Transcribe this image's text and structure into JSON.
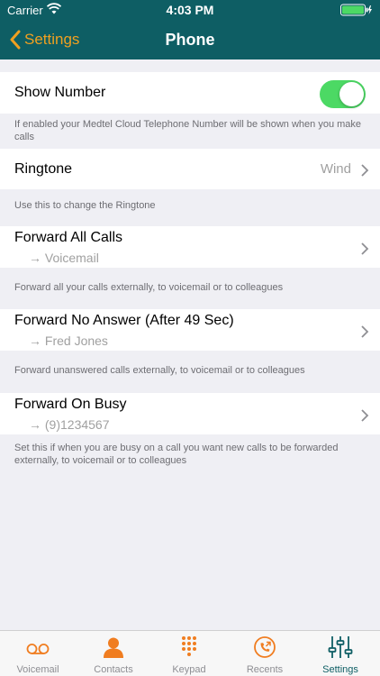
{
  "status": {
    "carrier": "Carrier",
    "time": "4:03 PM"
  },
  "nav": {
    "back_label": "Settings",
    "title": "Phone"
  },
  "colors": {
    "nav_bg": "#0e5e64",
    "accent": "#f0a020",
    "toggle_on": "#4cd964",
    "tab_active": "#0e5e64"
  },
  "show_number": {
    "label": "Show Number",
    "enabled": true,
    "footnote": "If enabled your Medtel Cloud Telephone Number will be shown when you make calls"
  },
  "ringtone": {
    "label": "Ringtone",
    "value": "Wind",
    "footnote": "Use this to change the Ringtone"
  },
  "forward_all": {
    "label": "Forward All Calls",
    "target": "→ Voicemail",
    "footnote": "Forward all your calls externally, to voicemail or to colleagues"
  },
  "forward_no_answer": {
    "label": "Forward No Answer (After 49 Sec)",
    "target": "→ Fred Jones",
    "footnote": "Forward unanswered calls externally, to voicemail or to colleagues"
  },
  "forward_busy": {
    "label": "Forward On Busy",
    "target": "→ (9)1234567",
    "footnote": "Set this if when you are busy on a call you want new calls to be forwarded externally, to voicemail or to colleagues"
  },
  "tabs": [
    {
      "label": "Voicemail",
      "icon": "voicemail-icon"
    },
    {
      "label": "Contacts",
      "icon": "contacts-icon"
    },
    {
      "label": "Keypad",
      "icon": "keypad-icon"
    },
    {
      "label": "Recents",
      "icon": "recents-icon"
    },
    {
      "label": "Settings",
      "icon": "settings-icon",
      "active": true
    }
  ]
}
